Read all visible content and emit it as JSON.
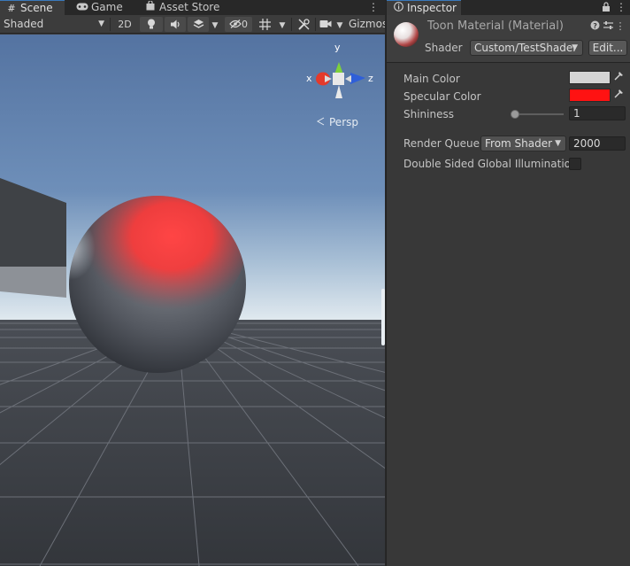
{
  "scene_panel": {
    "tabs": [
      {
        "label": "Scene",
        "icon": "hash-icon"
      },
      {
        "label": "Game",
        "icon": "gamepad-icon"
      },
      {
        "label": "Asset Store",
        "icon": "shopping-bag-icon"
      }
    ],
    "toolbar": {
      "draw_mode": "Shaded",
      "mode_2d": "2D",
      "hidden_count": "0",
      "gizmos_label": "Gizmos"
    },
    "gizmo": {
      "x_label": "x",
      "y_label": "y",
      "z_label": "z",
      "projection_label": "Persp"
    }
  },
  "inspector": {
    "tab_label": "Inspector",
    "material_title": "Toon Material (Material)",
    "shader_label": "Shader",
    "shader_value": "Custom/TestShader",
    "edit_button": "Edit...",
    "properties": {
      "main_color_label": "Main Color",
      "main_color_value": "#d4d4d4",
      "specular_color_label": "Specular Color",
      "specular_color_value": "#ff1212",
      "shininess_label": "Shininess",
      "shininess_value": "1",
      "render_queue_label": "Render Queue",
      "render_queue_mode": "From Shader",
      "render_queue_value": "2000",
      "double_sided_gi_label": "Double Sided Global Illumination",
      "double_sided_gi_checked": false
    }
  },
  "colors": {
    "accent": "#3a79bb",
    "sky_top": "#5577a6",
    "sky_horizon": "#dfe8ee",
    "ground": "#393c40",
    "sphere_highlight": "#ff4a4a",
    "axis_x": "#e43a2b",
    "axis_y": "#7ed13a",
    "axis_z": "#2f5fd8"
  }
}
